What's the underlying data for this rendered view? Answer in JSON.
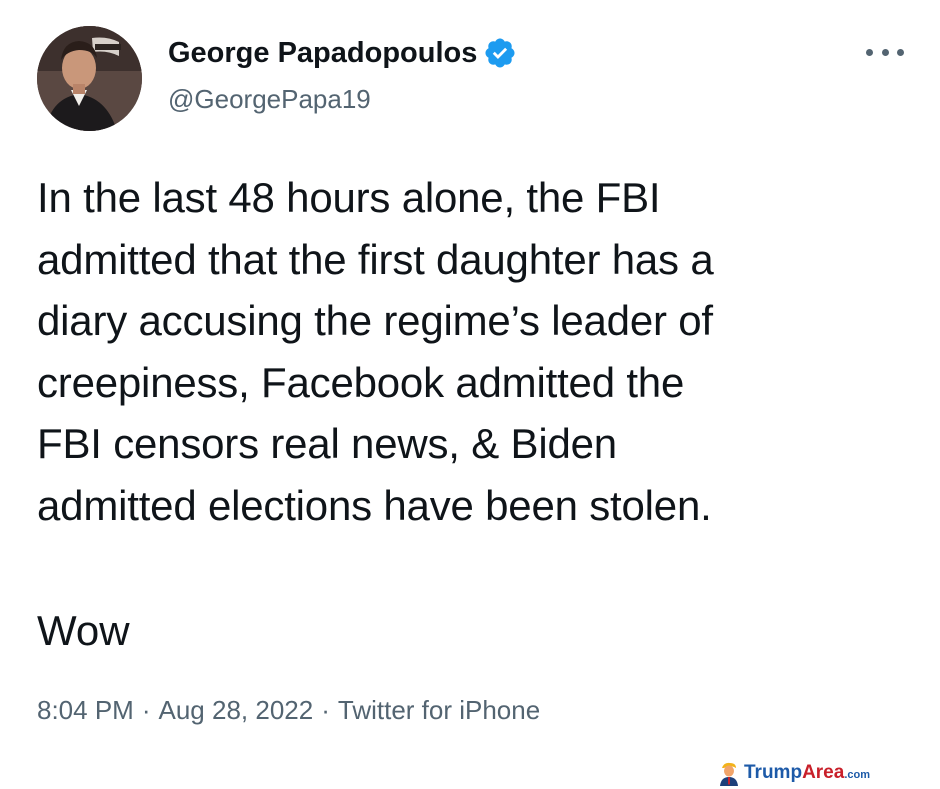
{
  "author": {
    "display_name": "George Papadopoulos",
    "handle": "@GeorgePapa19",
    "verified_icon": "verified-badge-icon",
    "verified_color": "#1d9bf0"
  },
  "tweet": {
    "lines": [
      "In the last 48 hours alone, the FBI",
      "admitted that the first daughter has a",
      "diary accusing the regime’s leader of",
      "creepiness, Facebook admitted the",
      "FBI censors real news, & Biden",
      "admitted elections have been stolen."
    ],
    "closing": "Wow"
  },
  "meta": {
    "time": "8:04 PM",
    "separator": "·",
    "date": "Aug 28, 2022",
    "source": "Twitter for iPhone"
  },
  "watermark": {
    "brand_part1": "Trump",
    "brand_part2": "Area",
    "brand_suffix": ".com"
  },
  "colors": {
    "text_primary": "#0f1419",
    "text_secondary": "#536471",
    "background": "#ffffff"
  }
}
